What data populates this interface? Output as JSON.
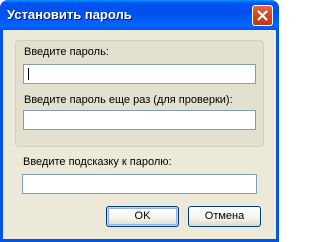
{
  "window": {
    "title": "Установить пароль"
  },
  "password": {
    "label": "Введите пароль:",
    "value": ""
  },
  "confirm": {
    "label": "Введите пароль еще раз (для проверки):",
    "value": ""
  },
  "hint": {
    "label": "Введите подсказку к паролю:",
    "value": ""
  },
  "buttons": {
    "ok": "OK",
    "cancel": "Отмена"
  },
  "icons": {
    "close": "close-icon"
  }
}
